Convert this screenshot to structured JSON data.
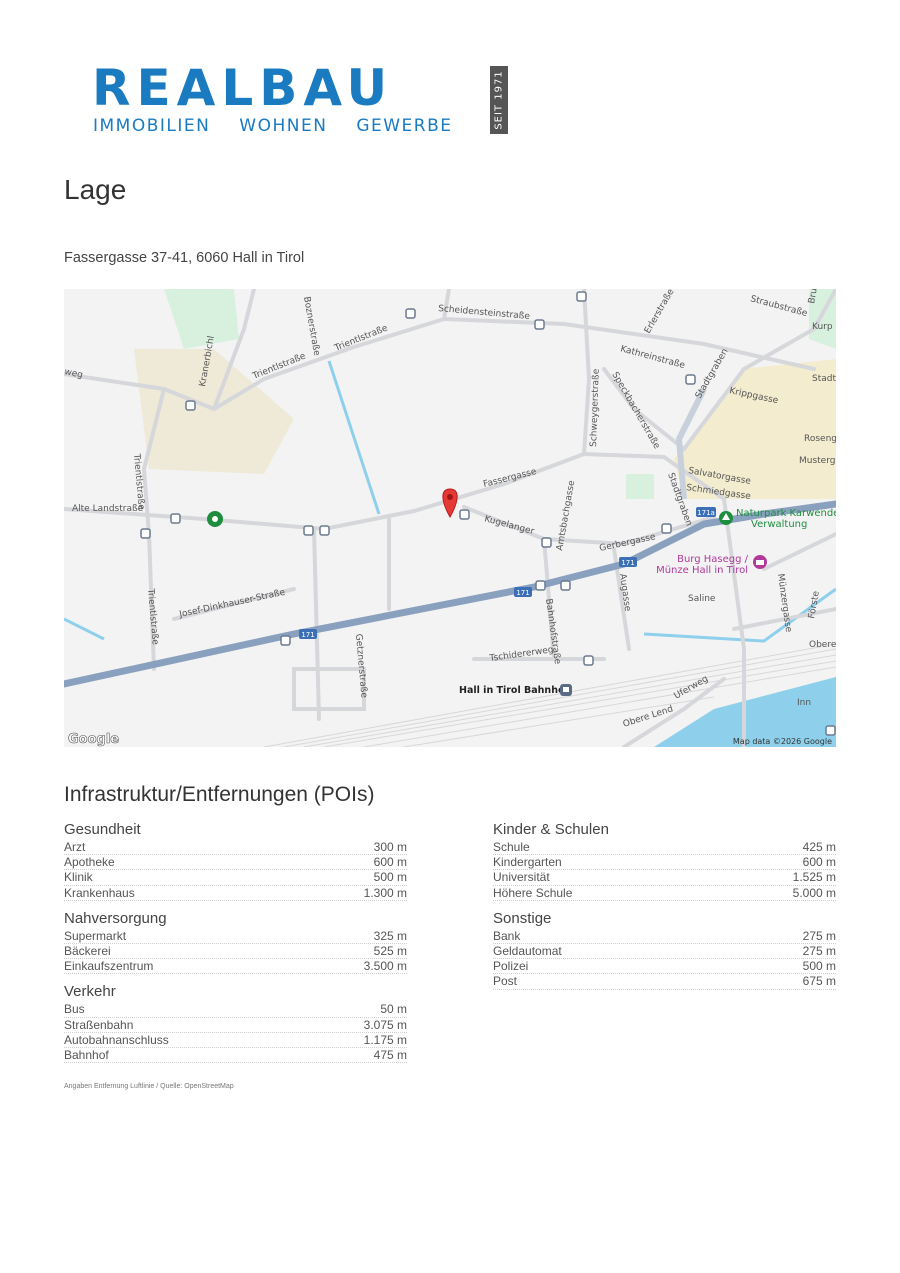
{
  "logo": {
    "word": "REALBAU",
    "sub": [
      "IMMOBILIEN",
      "WOHNEN",
      "GEWERBE"
    ],
    "seit": "SEIT 1971",
    "color": "#1a7bc0"
  },
  "page_title": "Lage",
  "address": "Fassergasse 37-41, 6060 Hall in Tirol",
  "map": {
    "streets": {
      "bozner": "Boznerstraße",
      "trientl1": "Trientlstraße",
      "trientl2": "Trientlstraße",
      "trientl3": "Trientlstraße",
      "trientl4": "Trientlstraße",
      "scheidenstein": "Scheidensteinstraße",
      "kranerbichl": "Kranerbichl",
      "weg": "weg",
      "alte_landstrasse": "Alte Landstraße",
      "fassergasse": "Fassergasse",
      "kugelanger": "Kugelanger",
      "amtsbachgasse": "Amtsbachgasse",
      "schweygerstrasse": "Schweygerstraße",
      "speckbacherstrasse": "Speckbacherstraße",
      "kathreinstrasse": "Kathreinstraße",
      "erlerstrasse": "Erlerstraße",
      "straubstrasse": "Straubstraße",
      "bru": "Bru",
      "kurp": "Kurp",
      "stadtgraben1": "Stadtgraben",
      "stadtgraben2": "Stadtgraben",
      "stadt": "Stadt",
      "krippgasse": "Krippgasse",
      "roseng": "Roseng",
      "musterg": "Musterg",
      "salvatorgasse": "Salvatorgasse",
      "schmiedgasse": "Schmiedgasse",
      "gerbergasse": "Gerbergasse",
      "augasse": "Augasse",
      "muenzergasse": "Münzergasse",
      "saline": "Saline",
      "forste": "Förste",
      "obere": "Obere",
      "josef_dinkhauser": "Josef-Dinkhauser-Straße",
      "getznerstrasse": "Getznerstraße",
      "bahnhofstrasse": "Bahnhofstraße",
      "tschidererweg": "Tschidererweg",
      "uferweg": "Uferweg",
      "obere_lend": "Obere Lend",
      "inn": "Inn",
      "route171a": "171",
      "route171b": "171",
      "route171c": "171",
      "route171d": "171a"
    },
    "pois": {
      "naturpark1": "Naturpark Karwendel",
      "naturpark2": "Verwaltung",
      "burg1": "Burg Hasegg /",
      "burg2": "Münze Hall in Tirol",
      "bahnhof": "Hall in Tirol Bahnhof"
    },
    "attribution_logo": "Google",
    "attribution": "Map data ©2026 Google",
    "marker_color": "#e53935"
  },
  "section_title": "Infrastruktur/Entfernungen (POIs)",
  "columns": {
    "left": [
      {
        "title": "Gesundheit",
        "rows": [
          {
            "label": "Arzt",
            "value": "300 m"
          },
          {
            "label": "Apotheke",
            "value": "600 m"
          },
          {
            "label": "Klinik",
            "value": "500 m"
          },
          {
            "label": "Krankenhaus",
            "value": "1.300 m"
          }
        ]
      },
      {
        "title": "Nahversorgung",
        "rows": [
          {
            "label": "Supermarkt",
            "value": "325 m"
          },
          {
            "label": "Bäckerei",
            "value": "525 m"
          },
          {
            "label": "Einkaufszentrum",
            "value": "3.500 m"
          }
        ]
      },
      {
        "title": "Verkehr",
        "rows": [
          {
            "label": "Bus",
            "value": "50 m"
          },
          {
            "label": "Straßenbahn",
            "value": "3.075 m"
          },
          {
            "label": "Autobahnanschluss",
            "value": "1.175 m"
          },
          {
            "label": "Bahnhof",
            "value": "475 m"
          }
        ]
      }
    ],
    "right": [
      {
        "title": "Kinder & Schulen",
        "rows": [
          {
            "label": "Schule",
            "value": "425 m"
          },
          {
            "label": "Kindergarten",
            "value": "600 m"
          },
          {
            "label": "Universität",
            "value": "1.525 m"
          },
          {
            "label": "Höhere Schule",
            "value": "5.000 m"
          }
        ]
      },
      {
        "title": "Sonstige",
        "rows": [
          {
            "label": "Bank",
            "value": "275 m"
          },
          {
            "label": "Geldautomat",
            "value": "275 m"
          },
          {
            "label": "Polizei",
            "value": "500 m"
          },
          {
            "label": "Post",
            "value": "675 m"
          }
        ]
      }
    ]
  },
  "footnote": "Angaben Entfernung Luftlinie / Quelle: OpenStreetMap"
}
